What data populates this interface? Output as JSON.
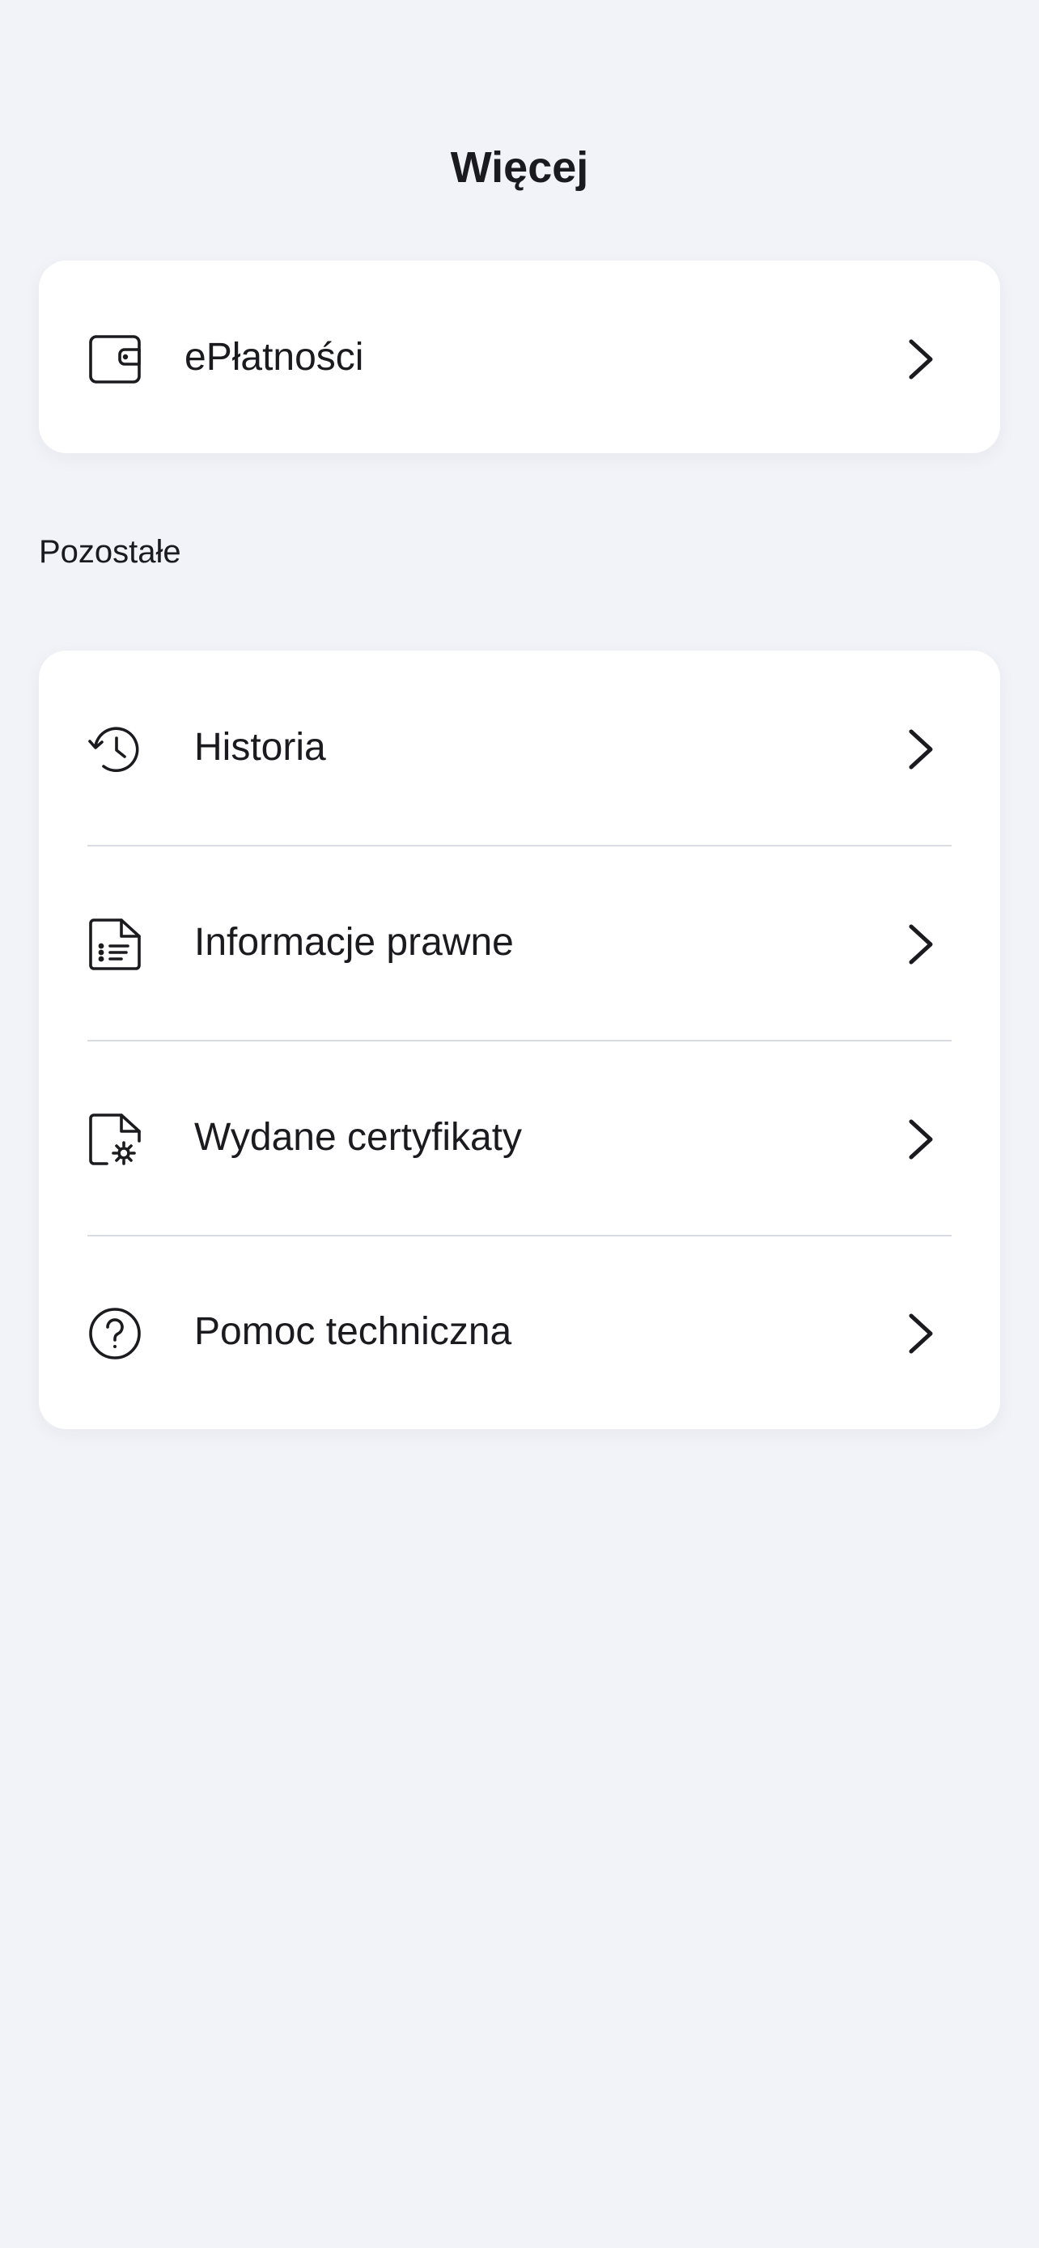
{
  "header": {
    "title": "Więcej"
  },
  "top_card": {
    "items": [
      {
        "label": "ePłatności",
        "icon": "wallet-icon"
      }
    ]
  },
  "other_section": {
    "title": "Pozostałe",
    "items": [
      {
        "label": "Historia",
        "icon": "history-icon"
      },
      {
        "label": "Informacje prawne",
        "icon": "legal-document-icon"
      },
      {
        "label": "Wydane certyfikaty",
        "icon": "certificate-document-icon"
      },
      {
        "label": "Pomoc techniczna",
        "icon": "help-circle-icon"
      }
    ]
  },
  "colors": {
    "background": "#f2f3f8",
    "card": "#ffffff",
    "text": "#1b1b1f",
    "divider": "#dadce3"
  }
}
